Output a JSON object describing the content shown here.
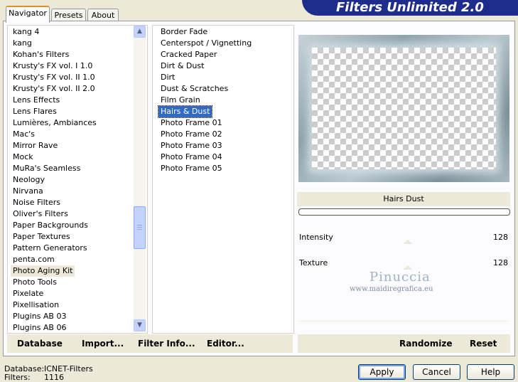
{
  "header": {
    "title": "Filters Unlimited 2.0"
  },
  "tabs": [
    {
      "label": "Navigator",
      "active": true
    },
    {
      "label": "Presets",
      "active": false
    },
    {
      "label": "About",
      "active": false
    }
  ],
  "categories": {
    "items": [
      "kang 4",
      "kang",
      "Kohan's Filters",
      "Krusty's FX vol. I 1.0",
      "Krusty's FX vol. II 1.0",
      "Krusty's FX vol. II 2.0",
      "Lens Effects",
      "Lens Flares",
      "Lumières, Ambiances",
      "Mac's",
      "Mirror Rave",
      "Mock",
      "MuRa's Seamless",
      "Neology",
      "Nirvana",
      "Noise Filters",
      "Oliver's Filters",
      "Paper Backgrounds",
      "Paper Textures",
      "Pattern Generators",
      "penta.com",
      "Photo Aging Kit",
      "Photo Tools",
      "Pixelate",
      "Pixellisation",
      "Plugins AB 03",
      "Plugins AB 06"
    ],
    "highlighted": "Photo Aging Kit"
  },
  "filters": {
    "items": [
      "Border Fade",
      "Centerspot / Vignetting",
      "Cracked Paper",
      "Dirt & Dust",
      "Dirt",
      "Dust & Scratches",
      "Film Grain",
      "Hairs & Dust",
      "Photo Frame 01",
      "Photo Frame 02",
      "Photo Frame 03",
      "Photo Frame 04",
      "Photo Frame 05"
    ],
    "selected": "Hairs & Dust"
  },
  "filter_panel": {
    "name": "Hairs  Dust",
    "controls": [
      {
        "label": "Intensity",
        "value": "128"
      },
      {
        "label": "Texture",
        "value": "128"
      }
    ]
  },
  "watermark": {
    "name": "Pinuccia",
    "url": "www.maidiregrafica.eu"
  },
  "bottom_bar": {
    "database": "Database",
    "import": "Import...",
    "filter_info": "Filter Info...",
    "editor": "Editor...",
    "randomize": "Randomize",
    "reset": "Reset"
  },
  "status": {
    "database_label": "Database:",
    "database_value": "ICNET-Filters",
    "filters_label": "Filters:",
    "filters_value": "1116"
  },
  "dialog_buttons": {
    "apply": "Apply",
    "cancel": "Cancel",
    "help": "Help"
  },
  "colors": {
    "accent": "#316ac5",
    "banner": "#1e2d8c",
    "tab_active_border": "#e68b2c"
  }
}
